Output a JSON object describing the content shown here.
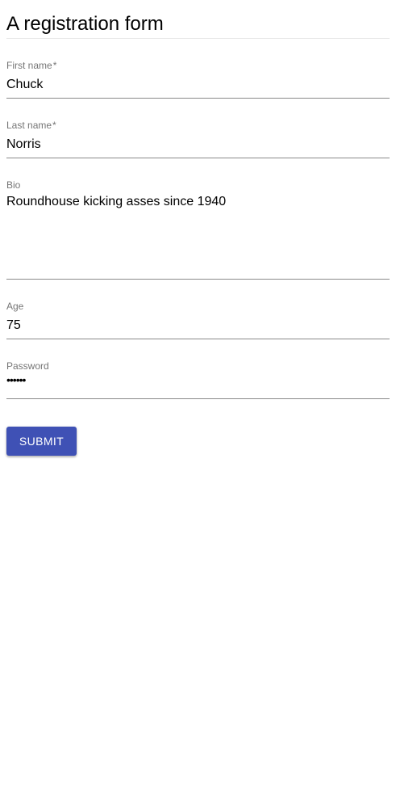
{
  "form": {
    "title": "A registration form",
    "first_name": {
      "label": "First name",
      "required_mark": "*",
      "value": "Chuck"
    },
    "last_name": {
      "label": "Last name",
      "required_mark": "*",
      "value": "Norris"
    },
    "bio": {
      "label": "Bio",
      "value": "Roundhouse kicking asses since 1940"
    },
    "age": {
      "label": "Age",
      "value": "75"
    },
    "password": {
      "label": "Password",
      "masked_value": "••••••"
    },
    "submit_label": "Submit"
  },
  "colors": {
    "primary": "#3f51b5",
    "label": "#757575",
    "underline": "#8a8a8a"
  }
}
